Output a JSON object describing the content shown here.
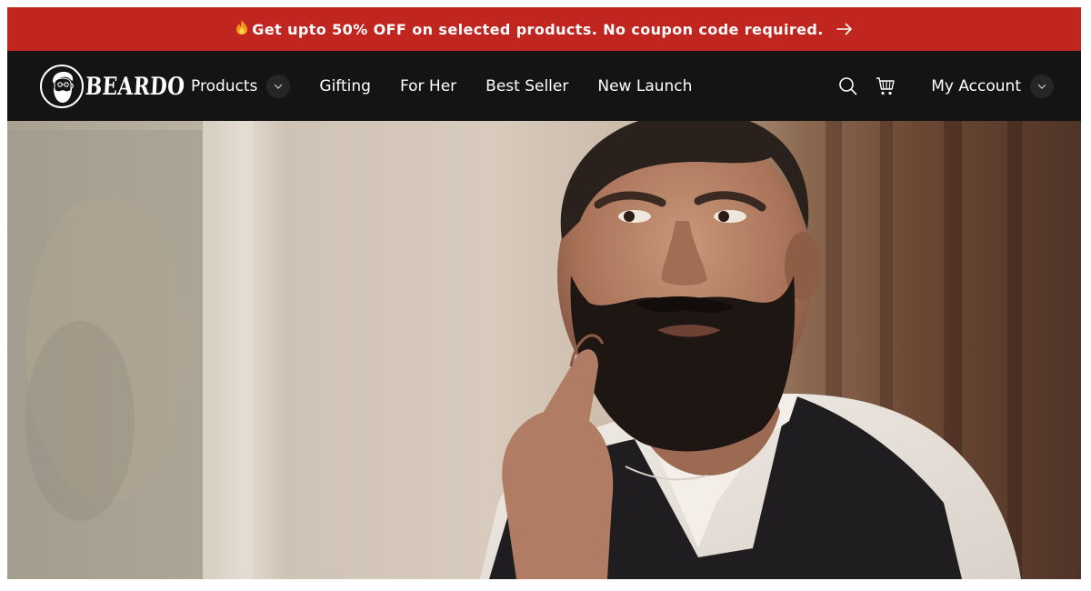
{
  "announcement": {
    "fire_icon": "fire-icon",
    "text": "Get upto 50% OFF on selected products. No coupon code required.",
    "arrow_icon": "arrow-right-icon"
  },
  "brand": {
    "name": "BEARDO",
    "logo_icon": "bearded-man-logo-icon"
  },
  "nav": {
    "items": [
      {
        "label": "Products",
        "has_dropdown": true
      },
      {
        "label": "Gifting",
        "has_dropdown": false
      },
      {
        "label": "For Her",
        "has_dropdown": false
      },
      {
        "label": "Best Seller",
        "has_dropdown": false
      },
      {
        "label": "New Launch",
        "has_dropdown": false
      }
    ]
  },
  "actions": {
    "search_icon": "search-icon",
    "cart_icon": "cart-icon",
    "account_label": "My Account",
    "account_chevron_icon": "chevron-down-icon"
  },
  "hero": {
    "image_icon": "hero-banner-image"
  },
  "colors": {
    "announcement_bg": "#c0251f",
    "header_bg": "#141414",
    "text": "#ffffff"
  }
}
